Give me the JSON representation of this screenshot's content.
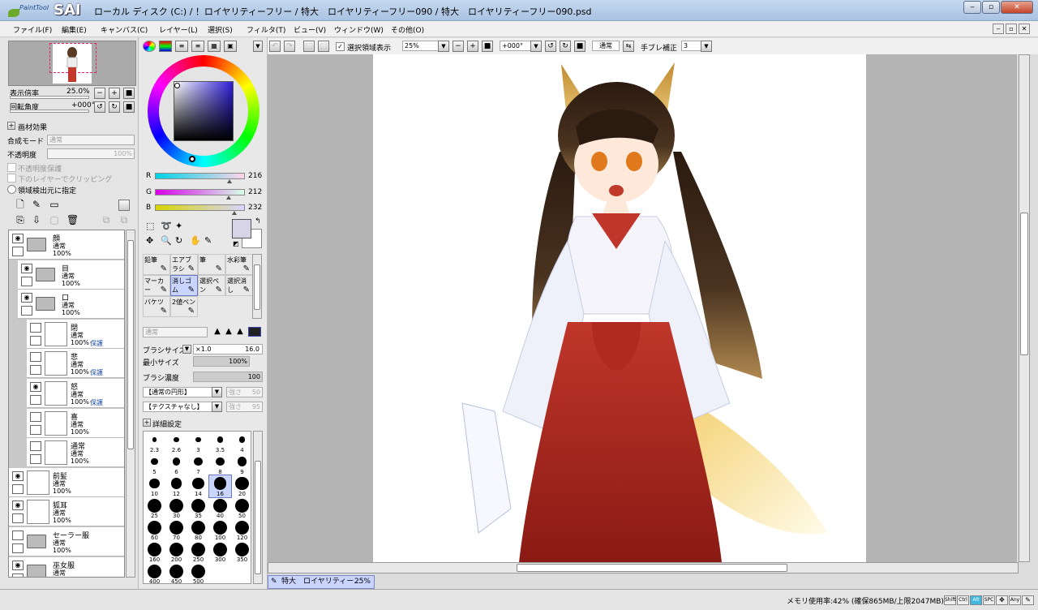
{
  "window": {
    "app_logo_small": "PaintTool",
    "app_logo_big": "SAI",
    "title": "ローカル ディスク (C:) / ！ロイヤリティーフリー / 特大　ロイヤリティーフリー090 / 特大　ロイヤリティーフリー090.psd",
    "min_label": "‒",
    "max_label": "▫",
    "close_label": "✕"
  },
  "menubar": {
    "items": [
      "ファイル(F)",
      "編集(E)",
      "キャンバス(C)",
      "レイヤー(L)",
      "選択(S)",
      "フィルタ(T)",
      "ビュー(V)",
      "ウィンドウ(W)",
      "その他(O)"
    ]
  },
  "navigator": {
    "zoom_label": "表示倍率",
    "zoom_value": "25.0%",
    "rotation_label": "回転角度",
    "rotation_value": "+000°"
  },
  "material": {
    "header": "画材効果",
    "blend_label": "合成モード",
    "blend_value": "通常",
    "opacity_label": "不透明度",
    "opacity_value": "100%",
    "lock_opacity": "不透明度保護",
    "clip_below": "下のレイヤーでクリッピング",
    "region_source": "領域検出元に指定"
  },
  "layers": [
    {
      "name": "顔",
      "mode": "通常",
      "opacity": "100%",
      "protect": "",
      "visible": true,
      "type": "folder",
      "indent": 0
    },
    {
      "name": "目",
      "mode": "通常",
      "opacity": "100%",
      "protect": "",
      "visible": true,
      "type": "folder",
      "indent": 1
    },
    {
      "name": "口",
      "mode": "通常",
      "opacity": "100%",
      "protect": "",
      "visible": true,
      "type": "folder",
      "indent": 1
    },
    {
      "name": "閉",
      "mode": "通常",
      "opacity": "100%",
      "protect": "保護",
      "visible": false,
      "type": "layer",
      "indent": 2
    },
    {
      "name": "悲",
      "mode": "通常",
      "opacity": "100%",
      "protect": "保護",
      "visible": false,
      "type": "layer",
      "indent": 2
    },
    {
      "name": "怒",
      "mode": "通常",
      "opacity": "100%",
      "protect": "保護",
      "visible": true,
      "type": "layer",
      "indent": 2
    },
    {
      "name": "喜",
      "mode": "通常",
      "opacity": "100%",
      "protect": "",
      "visible": false,
      "type": "layer",
      "indent": 2
    },
    {
      "name": "通常",
      "mode": "通常",
      "opacity": "100%",
      "protect": "",
      "visible": false,
      "type": "layer",
      "indent": 2
    },
    {
      "name": "前髪",
      "mode": "通常",
      "opacity": "100%",
      "protect": "",
      "visible": true,
      "type": "layer",
      "indent": 0
    },
    {
      "name": "狐耳",
      "mode": "通常",
      "opacity": "100%",
      "protect": "",
      "visible": true,
      "type": "layer",
      "indent": 0
    },
    {
      "name": "セーラー服",
      "mode": "通常",
      "opacity": "100%",
      "protect": "",
      "visible": false,
      "type": "folder",
      "indent": 0
    },
    {
      "name": "巫女服",
      "mode": "通常",
      "opacity": "",
      "protect": "",
      "visible": true,
      "type": "folder",
      "indent": 0
    }
  ],
  "color": {
    "r_label": "R",
    "r_value": "216",
    "g_label": "G",
    "g_value": "212",
    "b_label": "B",
    "b_value": "232",
    "fg": "#d8d4e8",
    "bg": "#ffffff"
  },
  "tools": [
    {
      "label": "鉛筆",
      "selected": false
    },
    {
      "label": "エアブラシ",
      "selected": false
    },
    {
      "label": "筆",
      "selected": false
    },
    {
      "label": "水彩筆",
      "selected": false
    },
    {
      "label": "マーカー",
      "selected": false
    },
    {
      "label": "消しゴム",
      "selected": true
    },
    {
      "label": "選択ペン",
      "selected": false
    },
    {
      "label": "選択消し",
      "selected": false
    },
    {
      "label": "バケツ",
      "selected": false
    },
    {
      "label": "2値ペン",
      "selected": false
    }
  ],
  "brush": {
    "mode_value": "通常",
    "size_label": "ブラシサイズ",
    "size_mult": "×1.0",
    "size_value": "16.0",
    "min_size_label": "最小サイズ",
    "min_size_value": "100%",
    "density_label": "ブラシ濃度",
    "density_value": "100",
    "shape_value": "【通常の円形】",
    "shape_strength_label": "強さ",
    "shape_strength_value": "50",
    "texture_value": "【テクスチャなし】",
    "texture_strength_label": "強さ",
    "texture_strength_value": "95",
    "detail_label": "詳細設定",
    "sizes": [
      "2.3",
      "2.6",
      "3",
      "3.5",
      "4",
      "5",
      "6",
      "7",
      "8",
      "9",
      "10",
      "12",
      "14",
      "16",
      "20",
      "25",
      "30",
      "35",
      "40",
      "50",
      "60",
      "70",
      "80",
      "100",
      "120",
      "160",
      "200",
      "250",
      "300",
      "350",
      "400",
      "450",
      "500"
    ],
    "selected_size": "16"
  },
  "canvas_toolbar": {
    "show_selection_label": "選択領域表示",
    "zoom_value": "25%",
    "rotation_value": "+000°",
    "blend_value": "通常",
    "stabilizer_label": "手ブレ補正",
    "stabilizer_value": "3"
  },
  "doc_tab": {
    "label": "特大　ロイヤリティー...",
    "zoom": "25%"
  },
  "status": {
    "memory": "メモリ使用率:42% (確保865MB/上限2047MB)",
    "keys": [
      "Shift",
      "Ctrl",
      "Alt",
      "SPC",
      "Any"
    ]
  }
}
